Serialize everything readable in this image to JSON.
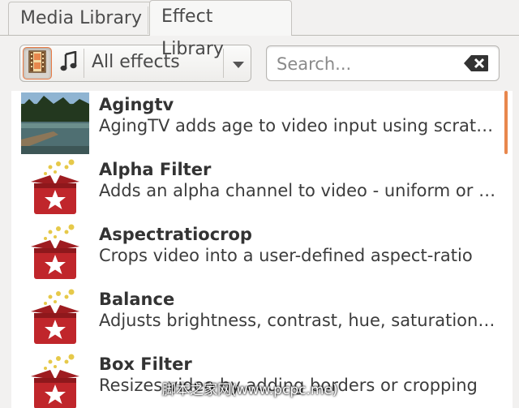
{
  "tabs": [
    {
      "label": "Media Library"
    },
    {
      "label": "Effect Library"
    }
  ],
  "toolbar": {
    "video_toggle_icon": "film-icon",
    "audio_toggle_icon": "music-note-icon",
    "filter_selected": "All effects",
    "search_placeholder": "Search...",
    "clear_icon": "backspace-clear-icon"
  },
  "effects": [
    {
      "name": "Agingtv",
      "description": "AgingTV adds age to video input using scratches and dust",
      "thumb": "landscape-thumbnail"
    },
    {
      "name": "Alpha Filter",
      "description": "Adds an alpha channel to video - uniform or using a chroma-key",
      "thumb": "gift-box-icon"
    },
    {
      "name": "Aspectratiocrop",
      "description": "Crops video into a user-defined aspect-ratio",
      "thumb": "gift-box-icon"
    },
    {
      "name": "Balance",
      "description": "Adjusts brightness, contrast, hue, saturation on a video stream",
      "thumb": "gift-box-icon"
    },
    {
      "name": "Box Filter",
      "description": "Resizes video by adding borders or cropping",
      "thumb": "gift-box-icon"
    }
  ],
  "colors": {
    "accent": "#e8874d",
    "box_red": "#c0262b"
  },
  "watermark": "脚本之家网(www.pcpc.me)"
}
